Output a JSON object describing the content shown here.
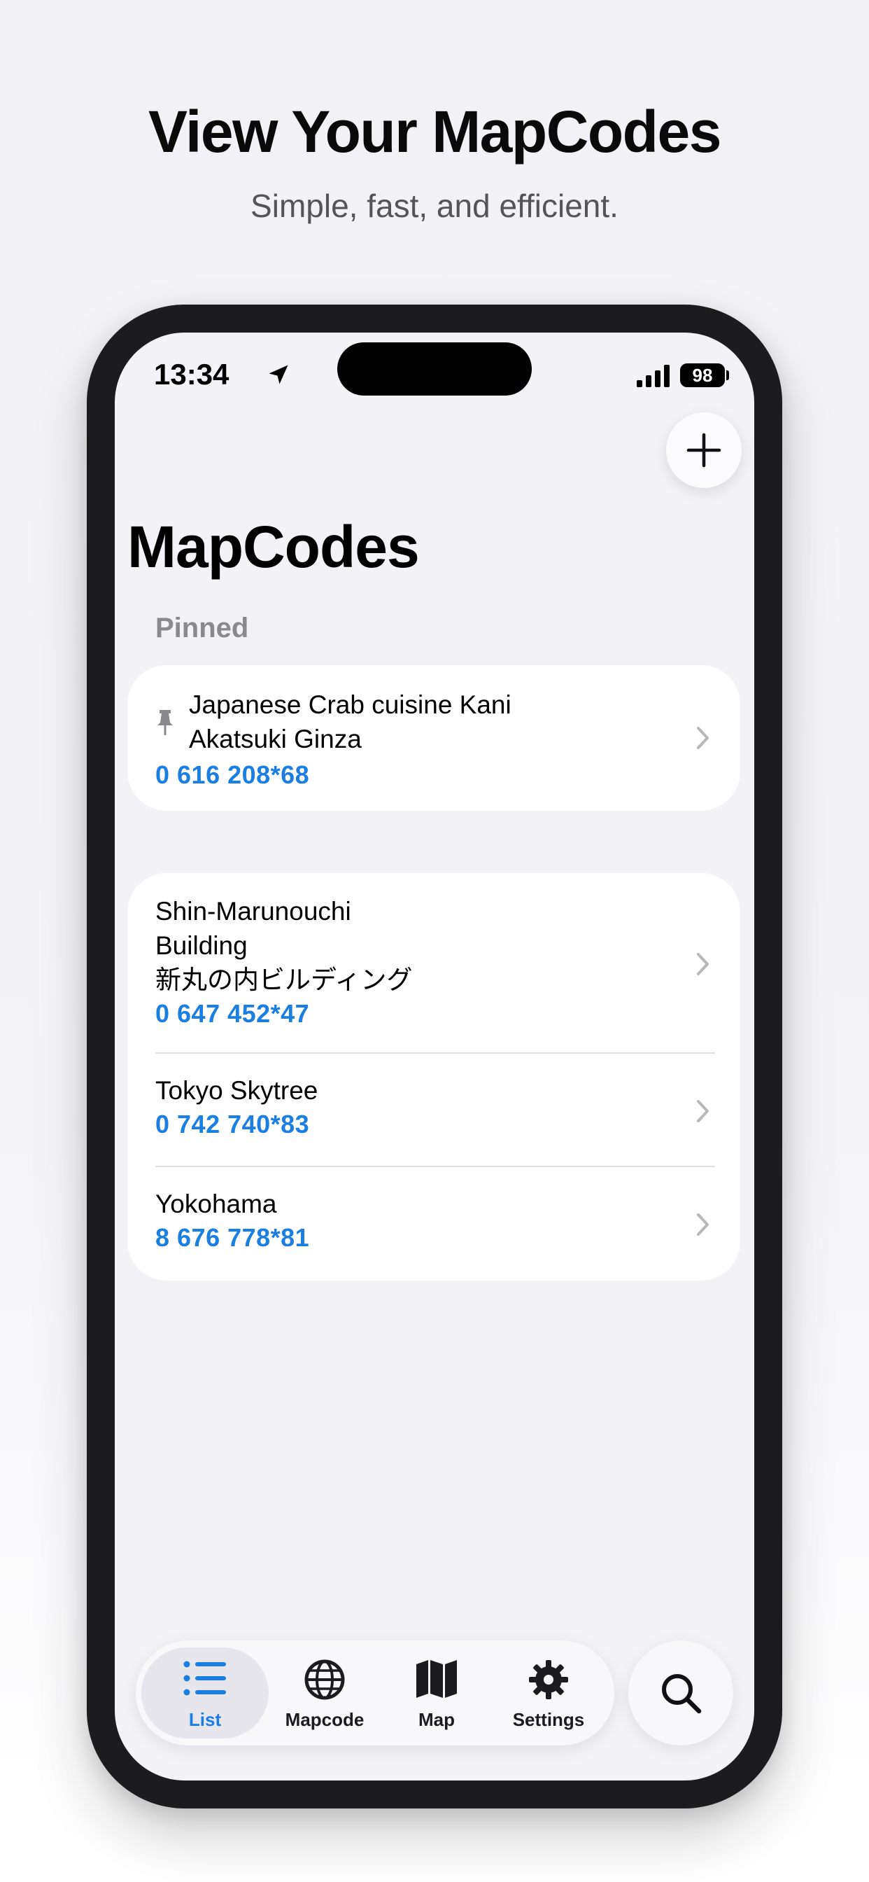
{
  "promo": {
    "headline": "View Your MapCodes",
    "subhead": "Simple, fast, and efficient."
  },
  "status_bar": {
    "time": "13:34",
    "battery": "98",
    "location_icon": "location-arrow-icon",
    "signal_icon": "cellular-signal-icon"
  },
  "nav": {
    "title": "MapCodes",
    "add_icon": "plus-icon"
  },
  "pinned": {
    "label": "Pinned",
    "items": [
      {
        "name_line1": "Japanese Crab cuisine Kani",
        "name_line2": "Akatsuki Ginza",
        "code": "0 616 208*68"
      }
    ]
  },
  "list": {
    "items": [
      {
        "name_line1": "Shin-Marunouchi",
        "name_line2": "Building",
        "name_line3": "新丸の内ビルディング",
        "code": "0 647 452*47"
      },
      {
        "name_line1": "Tokyo Skytree",
        "code": "0 742 740*83"
      },
      {
        "name_line1": "Yokohama",
        "code": "8 676 778*81"
      }
    ]
  },
  "tabbar": {
    "tabs": [
      {
        "label": "List",
        "icon": "list-icon",
        "active": true
      },
      {
        "label": "Mapcode",
        "icon": "globe-icon"
      },
      {
        "label": "Map",
        "icon": "map-icon"
      },
      {
        "label": "Settings",
        "icon": "gear-icon"
      }
    ],
    "search_icon": "magnifier-icon"
  },
  "colors": {
    "accent": "#1a7fe0",
    "background": "#f2f2f7",
    "phone_frame": "#1c1c1e"
  }
}
